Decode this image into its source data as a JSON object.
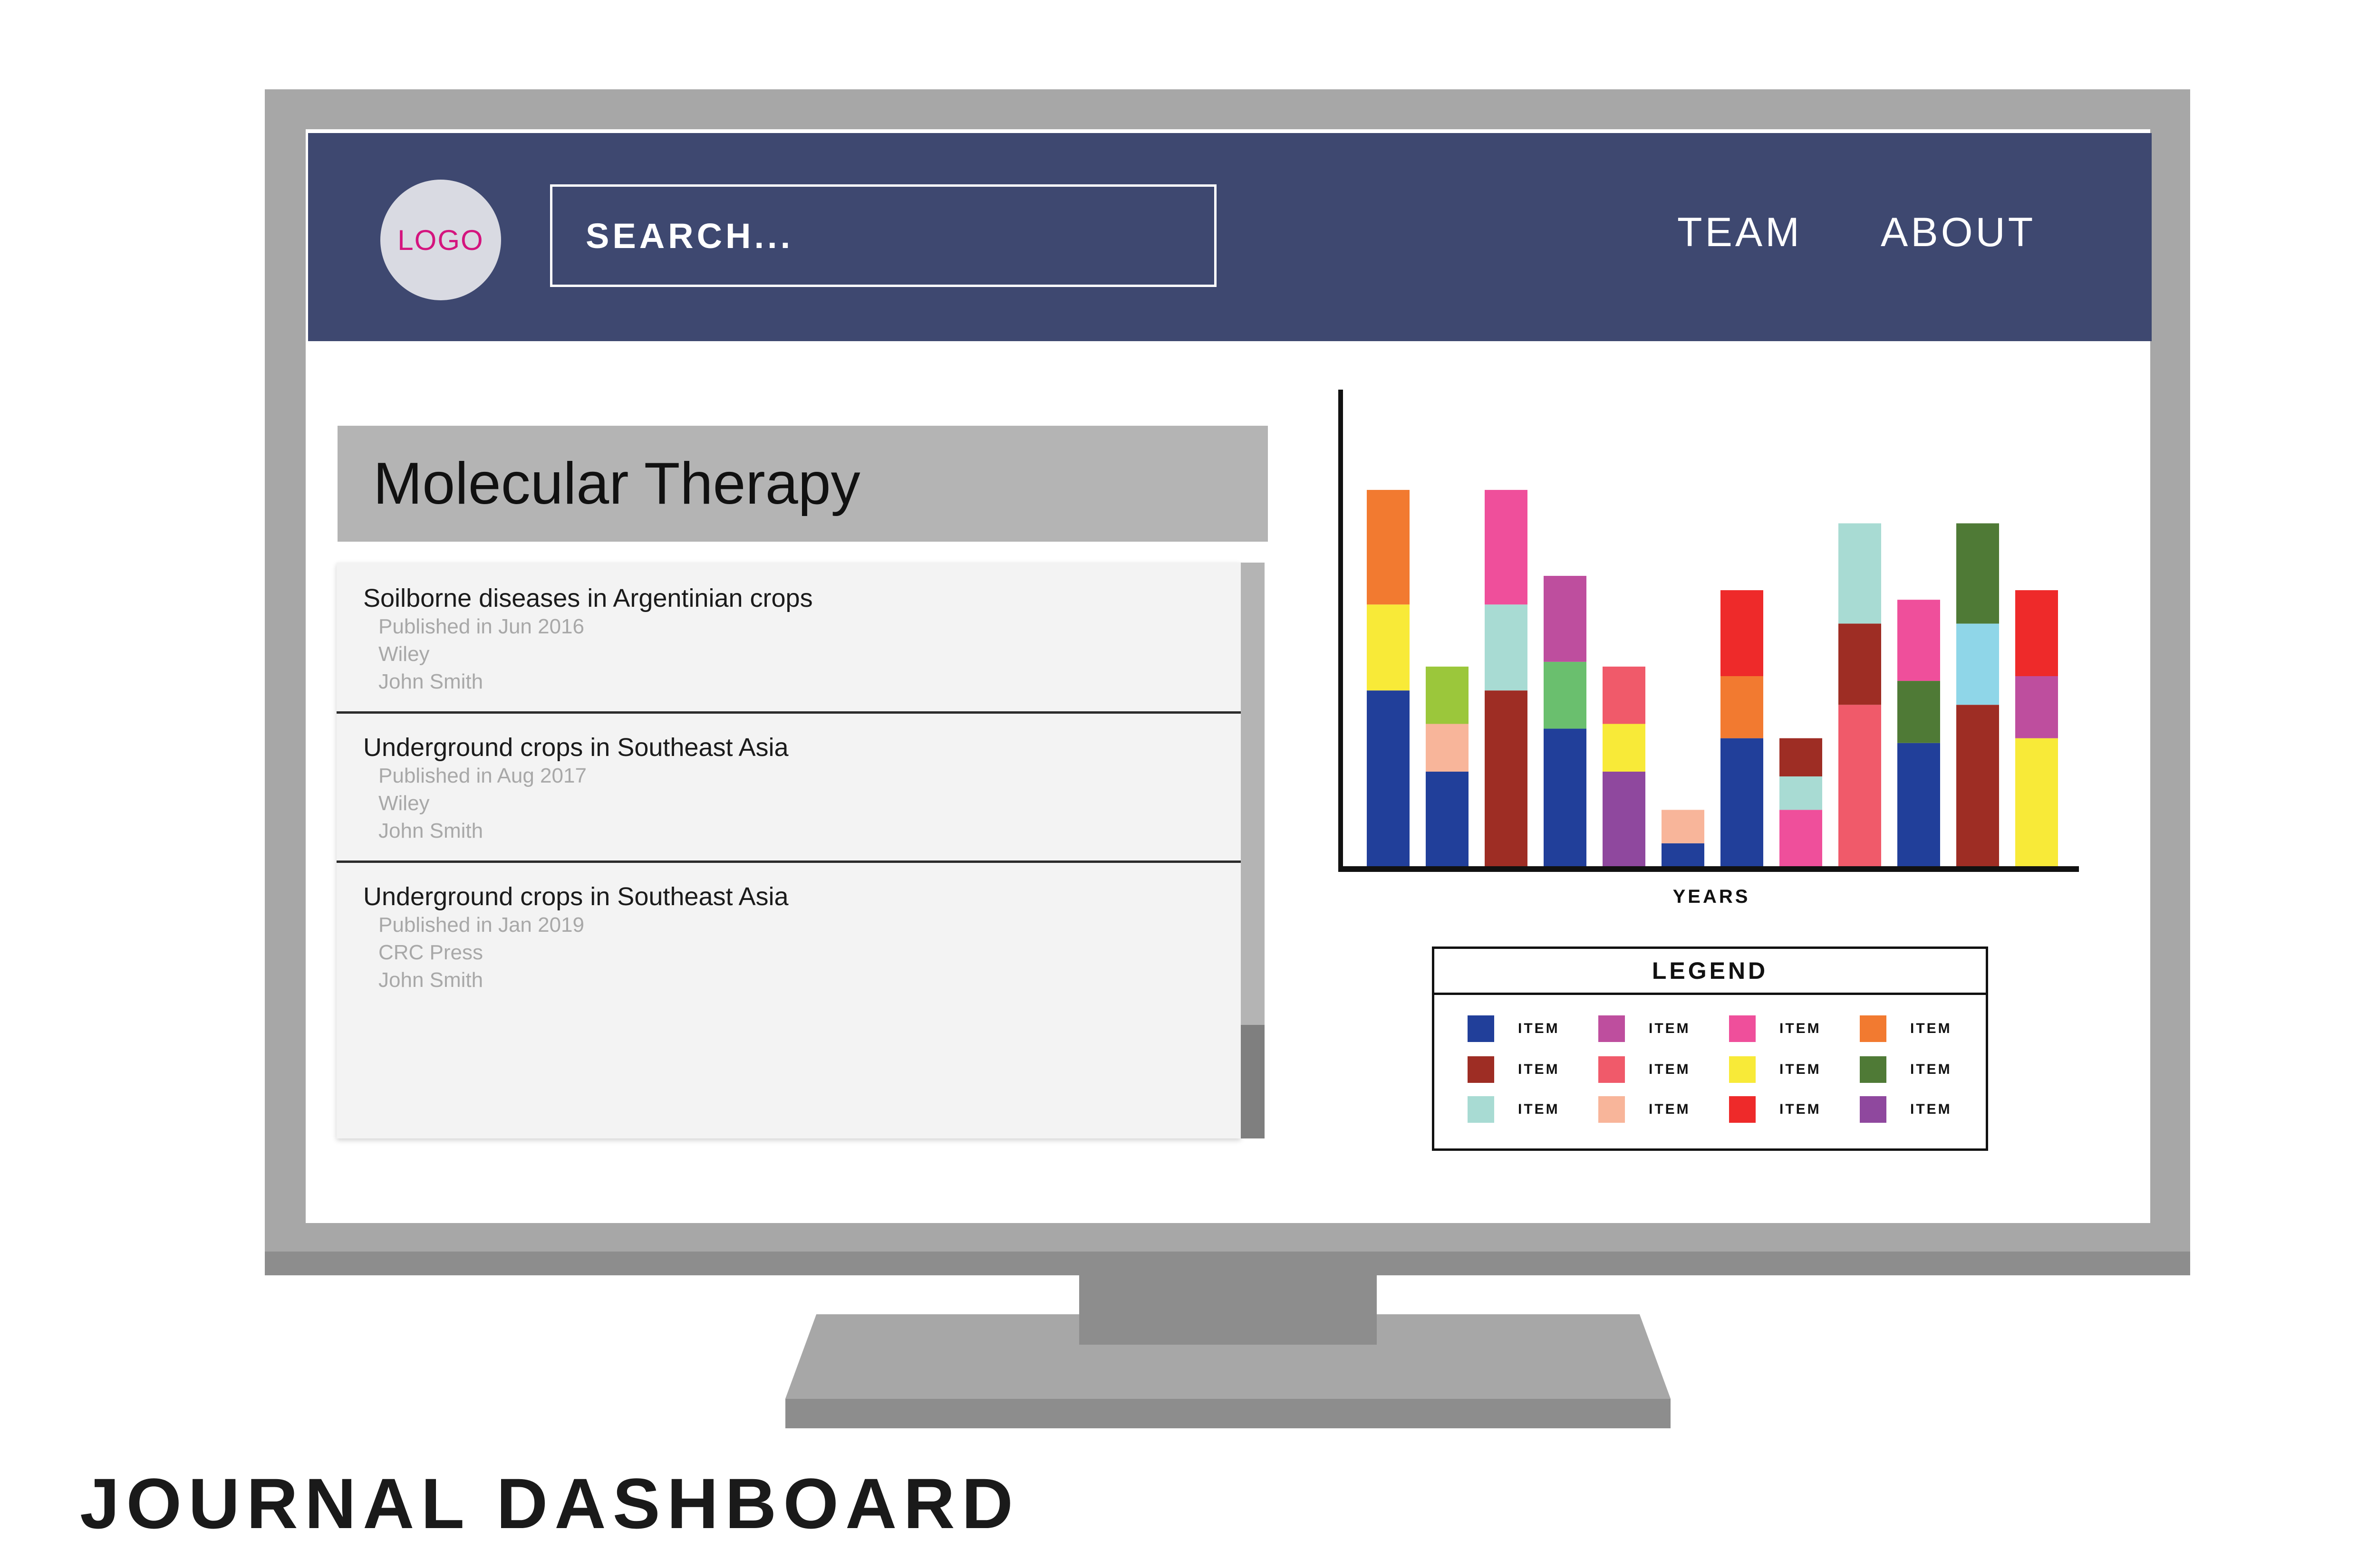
{
  "caption": "JOURNAL DASHBOARD",
  "header": {
    "logo": "LOGO",
    "search_text": "SEARCH...",
    "nav": [
      "TEAM",
      "ABOUT"
    ],
    "background": "#3e4870"
  },
  "journal": {
    "title": "Molecular Therapy",
    "articles": [
      {
        "title": "Soilborne diseases in Argentinian crops",
        "published": "Published in Jun 2016",
        "publisher": "Wiley",
        "author": "John Smith"
      },
      {
        "title": "Underground crops in Southeast Asia",
        "published": "Published in Aug 2017",
        "publisher": "Wiley",
        "author": "John Smith"
      },
      {
        "title": "Underground crops in Southeast Asia",
        "published": "Published in Jan 2019",
        "publisher": "CRC Press",
        "author": "John Smith"
      }
    ]
  },
  "chart_data": {
    "type": "bar",
    "stacked": true,
    "xlabel": "YEARS",
    "ylabel": "",
    "ylim": [
      0,
      100
    ],
    "grid": false,
    "bars": [
      [
        {
          "color": "#213f9a",
          "value": 37
        },
        {
          "color": "#f8ea38",
          "value": 18
        },
        {
          "color": "#f27a30",
          "value": 24
        }
      ],
      [
        {
          "color": "#213f9a",
          "value": 20
        },
        {
          "color": "#f8b59a",
          "value": 10
        },
        {
          "color": "#9bc73b",
          "value": 12
        }
      ],
      [
        {
          "color": "#9e2d24",
          "value": 37
        },
        {
          "color": "#a8dbd3",
          "value": 18
        },
        {
          "color": "#ef4f9b",
          "value": 24
        }
      ],
      [
        {
          "color": "#213f9a",
          "value": 29
        },
        {
          "color": "#6abf6e",
          "value": 14
        },
        {
          "color": "#be4e9e",
          "value": 18
        }
      ],
      [
        {
          "color": "#8f489e",
          "value": 20
        },
        {
          "color": "#f8ea38",
          "value": 10
        },
        {
          "color": "#f05a6a",
          "value": 12
        }
      ],
      [
        {
          "color": "#213f9a",
          "value": 5
        },
        {
          "color": "#f8b59a",
          "value": 7
        }
      ],
      [
        {
          "color": "#213f9a",
          "value": 27
        },
        {
          "color": "#f27a30",
          "value": 13
        },
        {
          "color": "#ee2a2a",
          "value": 18
        }
      ],
      [
        {
          "color": "#ef4f9b",
          "value": 12
        },
        {
          "color": "#a8dbd3",
          "value": 7
        },
        {
          "color": "#9e2d24",
          "value": 8
        }
      ],
      [
        {
          "color": "#f05a6a",
          "value": 34
        },
        {
          "color": "#9e2d24",
          "value": 17
        },
        {
          "color": "#a8dbd3",
          "value": 21
        }
      ],
      [
        {
          "color": "#213f9a",
          "value": 26
        },
        {
          "color": "#4f7a36",
          "value": 13
        },
        {
          "color": "#ef4f9b",
          "value": 17
        }
      ],
      [
        {
          "color": "#9e2d24",
          "value": 34
        },
        {
          "color": "#8fd6e8",
          "value": 17
        },
        {
          "color": "#4f7a36",
          "value": 21
        }
      ],
      [
        {
          "color": "#f8ea38",
          "value": 27
        },
        {
          "color": "#be4e9e",
          "value": 13
        },
        {
          "color": "#ee2a2a",
          "value": 18
        }
      ]
    ]
  },
  "legend": {
    "title": "LEGEND",
    "items": [
      {
        "color": "#213f9a",
        "label": "ITEM"
      },
      {
        "color": "#9e2d24",
        "label": "ITEM"
      },
      {
        "color": "#a8dbd3",
        "label": "ITEM"
      },
      {
        "color": "#be4e9e",
        "label": "ITEM"
      },
      {
        "color": "#f05a6a",
        "label": "ITEM"
      },
      {
        "color": "#f8b59a",
        "label": "ITEM"
      },
      {
        "color": "#ef4f9b",
        "label": "ITEM"
      },
      {
        "color": "#f8ea38",
        "label": "ITEM"
      },
      {
        "color": "#ee2a2a",
        "label": "ITEM"
      },
      {
        "color": "#f27a30",
        "label": "ITEM"
      },
      {
        "color": "#4f7a36",
        "label": "ITEM"
      },
      {
        "color": "#8f489e",
        "label": "ITEM"
      }
    ]
  }
}
